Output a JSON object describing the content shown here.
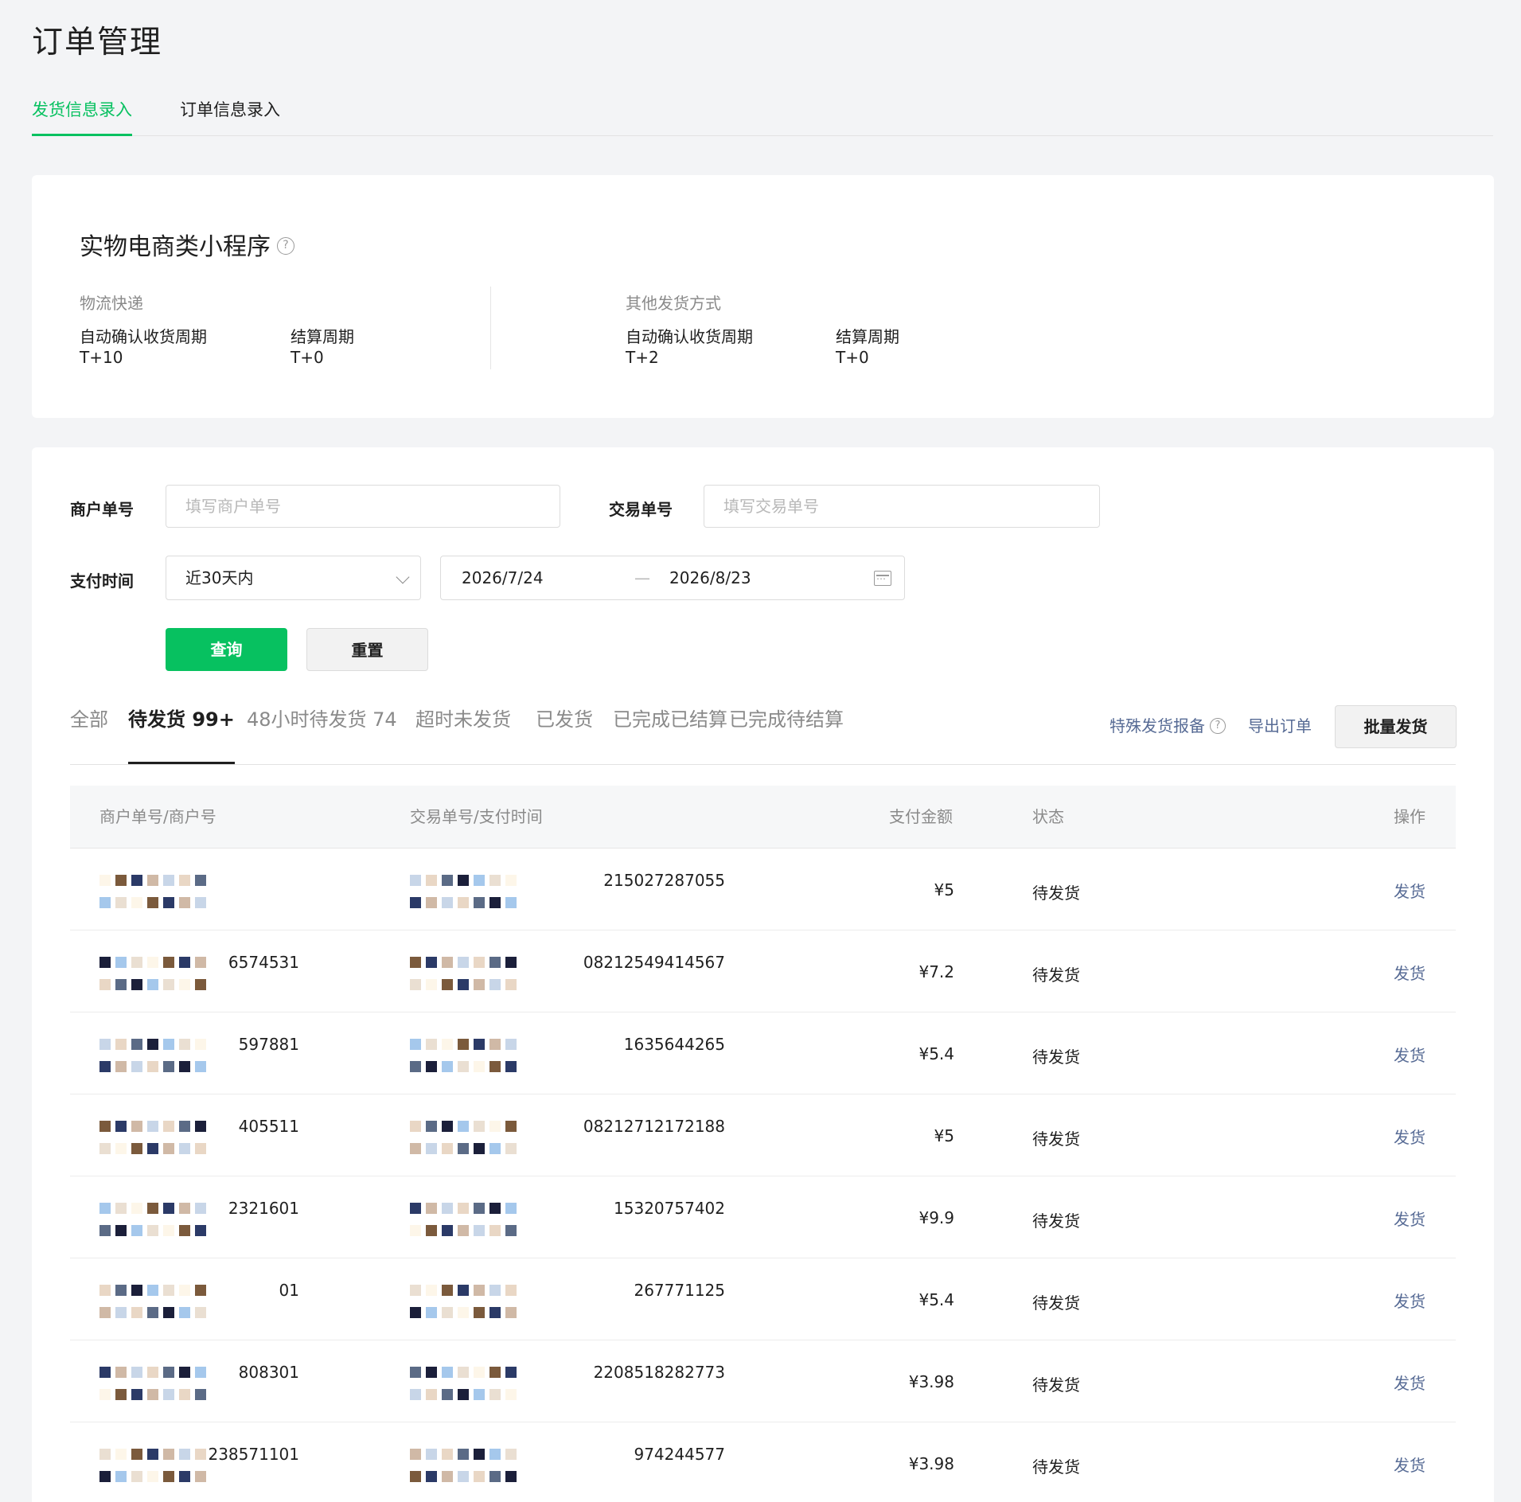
{
  "page": {
    "title": "订单管理"
  },
  "top_tabs": [
    {
      "label": "发货信息录入",
      "active": true
    },
    {
      "label": "订单信息录入",
      "active": false
    }
  ],
  "info_card": {
    "title": "实物电商类小程序",
    "groups": [
      {
        "name": "物流快递",
        "confirm_label": "自动确认收货周期",
        "confirm_value": "T+10",
        "settle_label": "结算周期",
        "settle_value": "T+0"
      },
      {
        "name": "其他发货方式",
        "confirm_label": "自动确认收货周期",
        "confirm_value": "T+2",
        "settle_label": "结算周期",
        "settle_value": "T+0"
      }
    ]
  },
  "search": {
    "merchant_label": "商户单号",
    "merchant_placeholder": "填写商户单号",
    "trade_label": "交易单号",
    "trade_placeholder": "填写交易单号",
    "paytime_label": "支付时间",
    "range_option": "近30天内",
    "date_start": "2026/7/24",
    "date_sep": "—",
    "date_end": "2026/8/23",
    "query_button": "查询",
    "reset_button": "重置"
  },
  "status_tabs": [
    {
      "label": "全部",
      "active": false
    },
    {
      "label": "待发货 99+",
      "active": true
    },
    {
      "label": "48小时待发货 74",
      "active": false
    },
    {
      "label": "超时未发货",
      "active": false
    },
    {
      "label": "已发货",
      "active": false
    },
    {
      "label": "已完成已结算",
      "active": false
    },
    {
      "label": "已完成待结算",
      "active": false
    }
  ],
  "actions": {
    "special_report": "特殊发货报备",
    "export": "导出订单",
    "batch_ship": "批量发货"
  },
  "table": {
    "columns": [
      "商户单号/商户号",
      "交易单号/支付时间",
      "支付金额",
      "状态",
      "操作"
    ],
    "rows": [
      {
        "merchant_no": "",
        "trade_no": "215027287055",
        "amount": "¥5",
        "status": "待发货",
        "action": "发货"
      },
      {
        "merchant_no": "6574531",
        "trade_no": "08212549414567",
        "amount": "¥7.2",
        "status": "待发货",
        "action": "发货"
      },
      {
        "merchant_no": "597881",
        "trade_no": "1635644265",
        "amount": "¥5.4",
        "status": "待发货",
        "action": "发货"
      },
      {
        "merchant_no": "405511",
        "trade_no": "08212712172188",
        "amount": "¥5",
        "status": "待发货",
        "action": "发货"
      },
      {
        "merchant_no": "2321601",
        "trade_no": "15320757402",
        "amount": "¥9.9",
        "status": "待发货",
        "action": "发货"
      },
      {
        "merchant_no": "01",
        "trade_no": "267771125",
        "amount": "¥5.4",
        "status": "待发货",
        "action": "发货"
      },
      {
        "merchant_no": "808301",
        "trade_no": "2208518282773",
        "amount": "¥3.98",
        "status": "待发货",
        "action": "发货"
      },
      {
        "merchant_no": "238571101",
        "trade_no": "974244577",
        "amount": "¥3.98",
        "status": "待发货",
        "action": "发货"
      }
    ]
  },
  "colors": {
    "accent": "#07c160",
    "link": "#576b95"
  }
}
